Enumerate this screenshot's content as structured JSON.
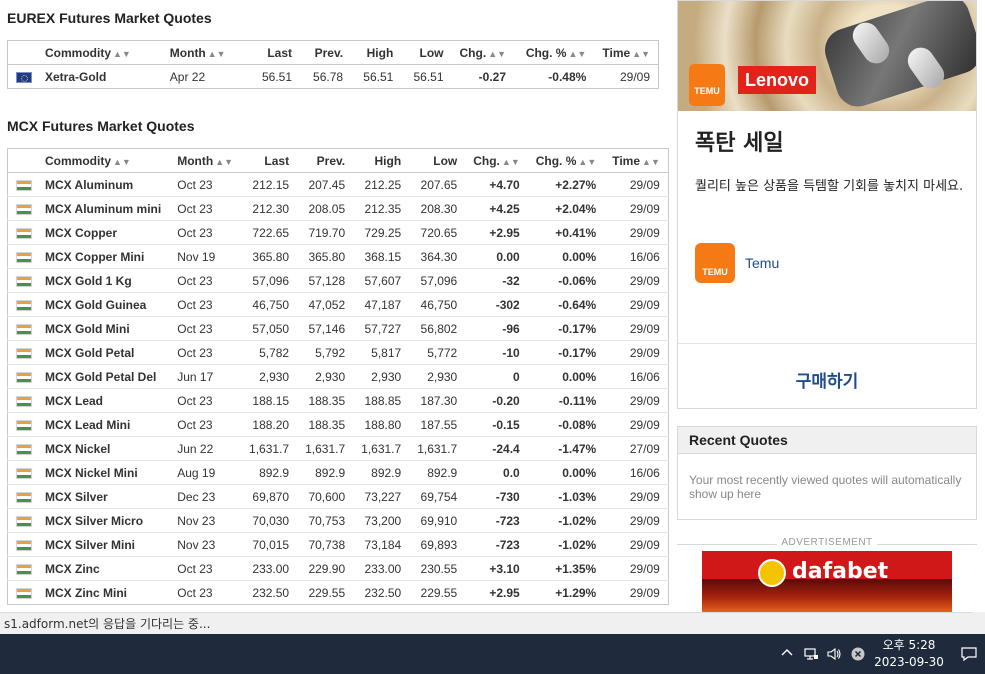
{
  "eurex": {
    "title": "EUREX Futures Market Quotes",
    "headers": {
      "commodity": "Commodity",
      "month": "Month",
      "last": "Last",
      "prev": "Prev.",
      "high": "High",
      "low": "Low",
      "chg": "Chg.",
      "chg_pct": "Chg. %",
      "time": "Time"
    },
    "rows": [
      {
        "name": "Xetra-Gold",
        "month": "Apr 22",
        "last": "56.51",
        "prev": "56.78",
        "high": "56.51",
        "low": "56.51",
        "chg": "-0.27",
        "chg_pct": "-0.48%",
        "time": "29/09",
        "dir": "down"
      }
    ]
  },
  "mcx": {
    "title": "MCX Futures Market Quotes",
    "headers": {
      "commodity": "Commodity",
      "month": "Month",
      "last": "Last",
      "prev": "Prev.",
      "high": "High",
      "low": "Low",
      "chg": "Chg.",
      "chg_pct": "Chg. %",
      "time": "Time"
    },
    "rows": [
      {
        "name": "MCX Aluminum",
        "month": "Oct 23",
        "last": "212.15",
        "prev": "207.45",
        "high": "212.25",
        "low": "207.65",
        "chg": "+4.70",
        "chg_pct": "+2.27%",
        "time": "29/09",
        "dir": "up"
      },
      {
        "name": "MCX Aluminum mini",
        "month": "Oct 23",
        "last": "212.30",
        "prev": "208.05",
        "high": "212.35",
        "low": "208.30",
        "chg": "+4.25",
        "chg_pct": "+2.04%",
        "time": "29/09",
        "dir": "up"
      },
      {
        "name": "MCX Copper",
        "month": "Oct 23",
        "last": "722.65",
        "prev": "719.70",
        "high": "729.25",
        "low": "720.65",
        "chg": "+2.95",
        "chg_pct": "+0.41%",
        "time": "29/09",
        "dir": "up"
      },
      {
        "name": "MCX Copper Mini",
        "month": "Nov 19",
        "last": "365.80",
        "prev": "365.80",
        "high": "368.15",
        "low": "364.30",
        "chg": "0.00",
        "chg_pct": "0.00%",
        "time": "16/06",
        "dir": "flat"
      },
      {
        "name": "MCX Gold 1 Kg",
        "month": "Oct 23",
        "last": "57,096",
        "prev": "57,128",
        "high": "57,607",
        "low": "57,096",
        "chg": "-32",
        "chg_pct": "-0.06%",
        "time": "29/09",
        "dir": "down"
      },
      {
        "name": "MCX Gold Guinea",
        "month": "Oct 23",
        "last": "46,750",
        "prev": "47,052",
        "high": "47,187",
        "low": "46,750",
        "chg": "-302",
        "chg_pct": "-0.64%",
        "time": "29/09",
        "dir": "down"
      },
      {
        "name": "MCX Gold Mini",
        "month": "Oct 23",
        "last": "57,050",
        "prev": "57,146",
        "high": "57,727",
        "low": "56,802",
        "chg": "-96",
        "chg_pct": "-0.17%",
        "time": "29/09",
        "dir": "down"
      },
      {
        "name": "MCX Gold Petal",
        "month": "Oct 23",
        "last": "5,782",
        "prev": "5,792",
        "high": "5,817",
        "low": "5,772",
        "chg": "-10",
        "chg_pct": "-0.17%",
        "time": "29/09",
        "dir": "down"
      },
      {
        "name": "MCX Gold Petal Del",
        "month": "Jun 17",
        "last": "2,930",
        "prev": "2,930",
        "high": "2,930",
        "low": "2,930",
        "chg": "0",
        "chg_pct": "0.00%",
        "time": "16/06",
        "dir": "flat"
      },
      {
        "name": "MCX Lead",
        "month": "Oct 23",
        "last": "188.15",
        "prev": "188.35",
        "high": "188.85",
        "low": "187.30",
        "chg": "-0.20",
        "chg_pct": "-0.11%",
        "time": "29/09",
        "dir": "down"
      },
      {
        "name": "MCX Lead Mini",
        "month": "Oct 23",
        "last": "188.20",
        "prev": "188.35",
        "high": "188.80",
        "low": "187.55",
        "chg": "-0.15",
        "chg_pct": "-0.08%",
        "time": "29/09",
        "dir": "down"
      },
      {
        "name": "MCX Nickel",
        "month": "Jun 22",
        "last": "1,631.7",
        "prev": "1,631.7",
        "high": "1,631.7",
        "low": "1,631.7",
        "chg": "-24.4",
        "chg_pct": "-1.47%",
        "time": "27/09",
        "dir": "down"
      },
      {
        "name": "MCX Nickel Mini",
        "month": "Aug 19",
        "last": "892.9",
        "prev": "892.9",
        "high": "892.9",
        "low": "892.9",
        "chg": "0.0",
        "chg_pct": "0.00%",
        "time": "16/06",
        "dir": "flat"
      },
      {
        "name": "MCX Silver",
        "month": "Dec 23",
        "last": "69,870",
        "prev": "70,600",
        "high": "73,227",
        "low": "69,754",
        "chg": "-730",
        "chg_pct": "-1.03%",
        "time": "29/09",
        "dir": "down"
      },
      {
        "name": "MCX Silver Micro",
        "month": "Nov 23",
        "last": "70,030",
        "prev": "70,753",
        "high": "73,200",
        "low": "69,910",
        "chg": "-723",
        "chg_pct": "-1.02%",
        "time": "29/09",
        "dir": "down"
      },
      {
        "name": "MCX Silver Mini",
        "month": "Nov 23",
        "last": "70,015",
        "prev": "70,738",
        "high": "73,184",
        "low": "69,893",
        "chg": "-723",
        "chg_pct": "-1.02%",
        "time": "29/09",
        "dir": "down"
      },
      {
        "name": "MCX Zinc",
        "month": "Oct 23",
        "last": "233.00",
        "prev": "229.90",
        "high": "233.00",
        "low": "230.55",
        "chg": "+3.10",
        "chg_pct": "+1.35%",
        "time": "29/09",
        "dir": "up"
      },
      {
        "name": "MCX Zinc Mini",
        "month": "Oct 23",
        "last": "232.50",
        "prev": "229.55",
        "high": "232.50",
        "low": "229.55",
        "chg": "+2.95",
        "chg_pct": "+1.29%",
        "time": "29/09",
        "dir": "up"
      }
    ]
  },
  "ad": {
    "temu_badge": "TEMU",
    "lenovo": "Lenovo",
    "headline": "폭탄 세일",
    "description": "퀄리티 높은 상품을 득템할 기회를 놓치지 마세요.",
    "brand": "Temu",
    "cta": "구매하기"
  },
  "recent_quotes": {
    "title": "Recent Quotes",
    "body": "Your most recently viewed quotes will automatically show up here"
  },
  "advertisement_label": "ADVERTISEMENT",
  "dafabet": {
    "logo": "dafabet"
  },
  "status_bar": {
    "text": "s1.adform.net의 응답을 기다리는 중..."
  },
  "taskbar": {
    "time": "오후 5:28",
    "date": "2023-09-30"
  },
  "colors": {
    "up": "#1a9c1a",
    "down": "#e01010",
    "link": "#1e4c8f",
    "taskbar": "#1f2a3d"
  }
}
